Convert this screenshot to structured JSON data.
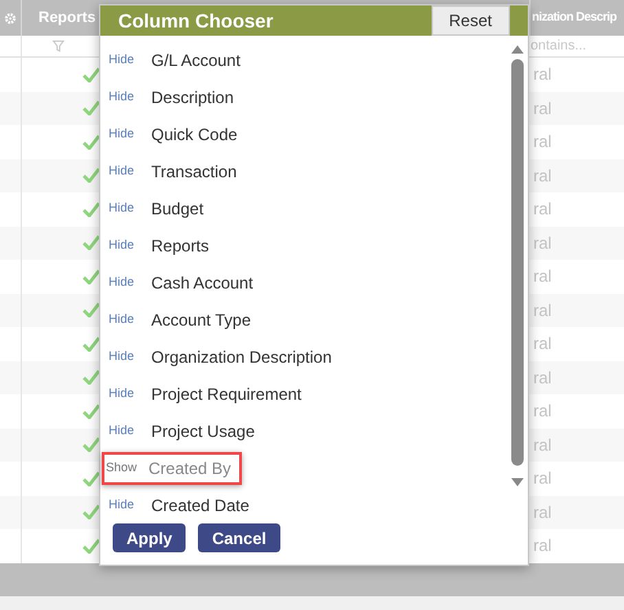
{
  "grid": {
    "columns": [
      {
        "label": "Reports",
        "filter": true
      },
      {
        "label": "nization Descrip",
        "placeholder": "ontains..."
      }
    ],
    "rows": [
      {
        "reports": true,
        "column_3": "ral"
      },
      {
        "reports": true,
        "column_3": "ral"
      },
      {
        "reports": true,
        "column_3": "ral"
      },
      {
        "reports": true,
        "column_3": "ral"
      },
      {
        "reports": true,
        "column_3": "ral"
      },
      {
        "reports": true,
        "column_3": "ral"
      },
      {
        "reports": true,
        "column_3": "ral"
      },
      {
        "reports": true,
        "column_3": "ral"
      },
      {
        "reports": true,
        "column_3": "ral"
      },
      {
        "reports": true,
        "column_3": "ral"
      },
      {
        "reports": true,
        "column_3": "ral"
      },
      {
        "reports": true,
        "column_3": "ral"
      },
      {
        "reports": true,
        "column_3": "ral"
      },
      {
        "reports": true,
        "column_3": "ral"
      },
      {
        "reports": true,
        "column_3": "ral"
      }
    ]
  },
  "dialog": {
    "title": "Column Chooser",
    "reset": "Reset",
    "items": [
      {
        "action": "Hide",
        "label": "G/L Account",
        "visible": true,
        "highlighted": false
      },
      {
        "action": "Hide",
        "label": "Description",
        "visible": true,
        "highlighted": false
      },
      {
        "action": "Hide",
        "label": "Quick Code",
        "visible": true,
        "highlighted": false
      },
      {
        "action": "Hide",
        "label": "Transaction",
        "visible": true,
        "highlighted": false
      },
      {
        "action": "Hide",
        "label": "Budget",
        "visible": true,
        "highlighted": false
      },
      {
        "action": "Hide",
        "label": "Reports",
        "visible": true,
        "highlighted": false
      },
      {
        "action": "Hide",
        "label": "Cash Account",
        "visible": true,
        "highlighted": false
      },
      {
        "action": "Hide",
        "label": "Account Type",
        "visible": true,
        "highlighted": false
      },
      {
        "action": "Hide",
        "label": "Organization Description",
        "visible": true,
        "highlighted": false
      },
      {
        "action": "Hide",
        "label": "Project Requirement",
        "visible": true,
        "highlighted": false
      },
      {
        "action": "Hide",
        "label": "Project Usage",
        "visible": true,
        "highlighted": false
      },
      {
        "action": "Show",
        "label": "Created By",
        "visible": false,
        "highlighted": true
      },
      {
        "action": "Hide",
        "label": "Created Date",
        "visible": true,
        "highlighted": false
      }
    ],
    "buttons": [
      "Apply",
      "Cancel"
    ]
  }
}
